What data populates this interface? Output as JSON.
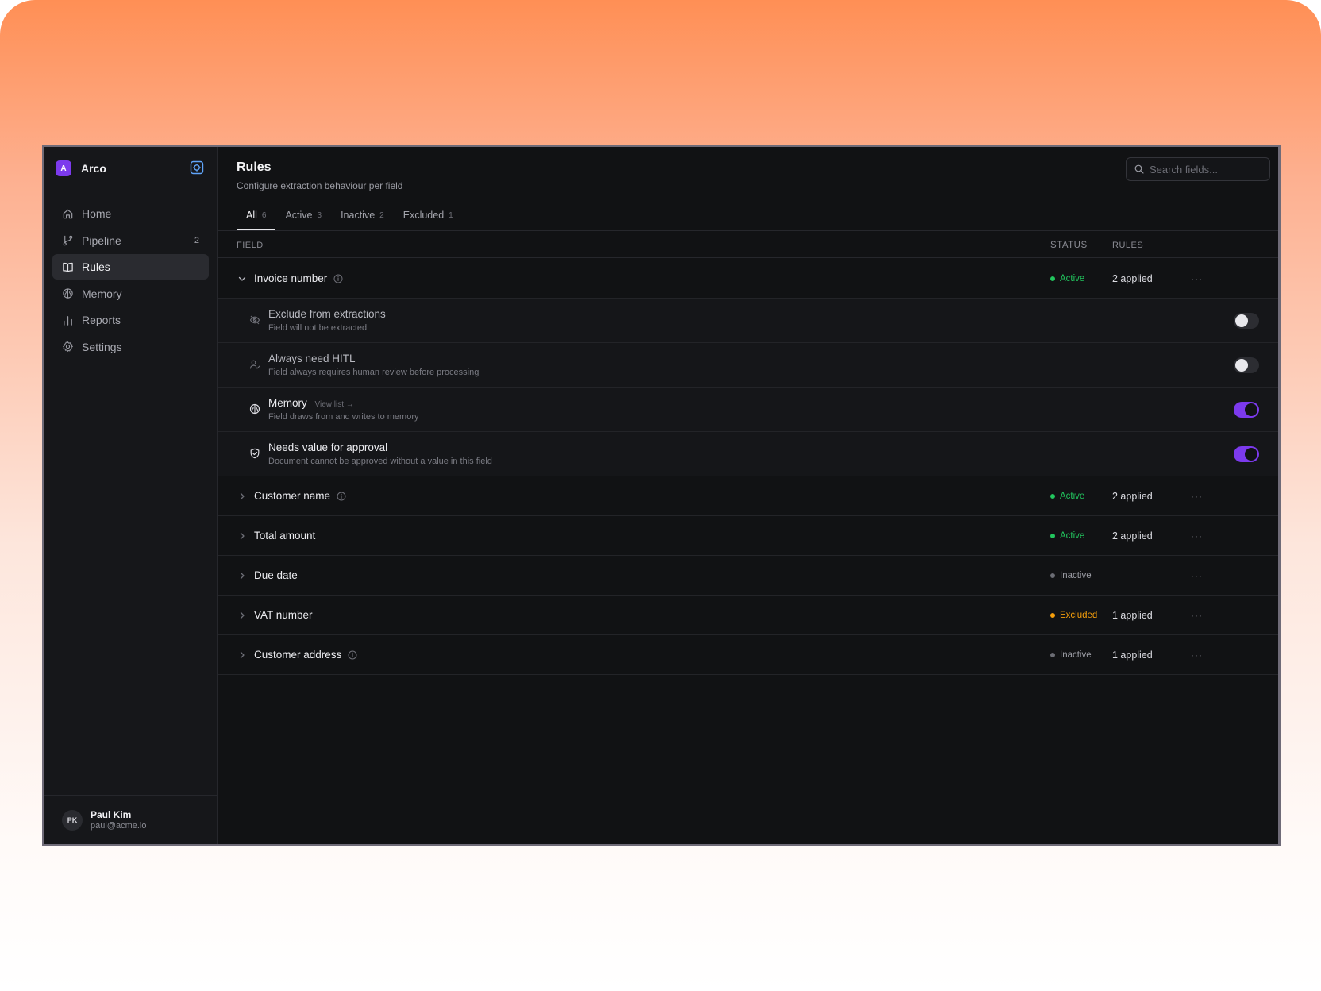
{
  "brand": {
    "logo_letter": "A",
    "name": "Arco"
  },
  "sidebar": {
    "items": [
      {
        "label": "Home",
        "icon": "home-icon",
        "badge": ""
      },
      {
        "label": "Pipeline",
        "icon": "branch-icon",
        "badge": "2"
      },
      {
        "label": "Rules",
        "icon": "book-icon",
        "badge": "",
        "active": true
      },
      {
        "label": "Memory",
        "icon": "brain-icon",
        "badge": ""
      },
      {
        "label": "Reports",
        "icon": "bar-chart-icon",
        "badge": ""
      },
      {
        "label": "Settings",
        "icon": "gear-icon",
        "badge": ""
      }
    ]
  },
  "user": {
    "initials": "PK",
    "name": "Paul Kim",
    "email": "paul@acme.io"
  },
  "header": {
    "title": "Rules",
    "subtitle": "Configure extraction behaviour per field",
    "search_placeholder": "Search fields..."
  },
  "tabs": [
    {
      "label": "All",
      "count": "6",
      "active": true
    },
    {
      "label": "Active",
      "count": "3"
    },
    {
      "label": "Inactive",
      "count": "2"
    },
    {
      "label": "Excluded",
      "count": "1"
    }
  ],
  "table": {
    "columns": {
      "field": "FIELD",
      "status": "STATUS",
      "rules": "RULES"
    },
    "expanded_field": {
      "name": "Invoice number",
      "status": "Active",
      "rules": "2 applied",
      "more": "···",
      "sub_rules": [
        {
          "title": "Exclude from extractions",
          "link": "",
          "desc": "Field will not be extracted",
          "icon": "eye-off-icon",
          "enabled": false
        },
        {
          "title": "Always need HITL",
          "link": "",
          "desc": "Field always requires human review before processing",
          "icon": "user-check-icon",
          "enabled": false
        },
        {
          "title": "Memory",
          "link": "View list →",
          "desc": "Field draws from and writes to memory",
          "icon": "brain-icon",
          "enabled": true
        },
        {
          "title": "Needs value for approval",
          "link": "",
          "desc": "Document cannot be approved without a value in this field",
          "icon": "shield-check-icon",
          "enabled": true
        }
      ]
    },
    "rows": [
      {
        "name": "Customer name",
        "info": true,
        "status": "Active",
        "rules": "2 applied",
        "more": "···"
      },
      {
        "name": "Total amount",
        "info": false,
        "status": "Active",
        "rules": "2 applied",
        "more": "···"
      },
      {
        "name": "Due date",
        "info": false,
        "status": "Inactive",
        "rules": "—",
        "more": "···"
      },
      {
        "name": "VAT number",
        "info": false,
        "status": "Excluded",
        "rules": "1 applied",
        "more": "···"
      },
      {
        "name": "Customer address",
        "info": true,
        "status": "Inactive",
        "rules": "1 applied",
        "more": "···"
      }
    ]
  },
  "colors": {
    "accent": "#7c3aed",
    "status_active": "#22c55e",
    "status_inactive": "#6b6c74",
    "status_excluded": "#f59e0b"
  }
}
